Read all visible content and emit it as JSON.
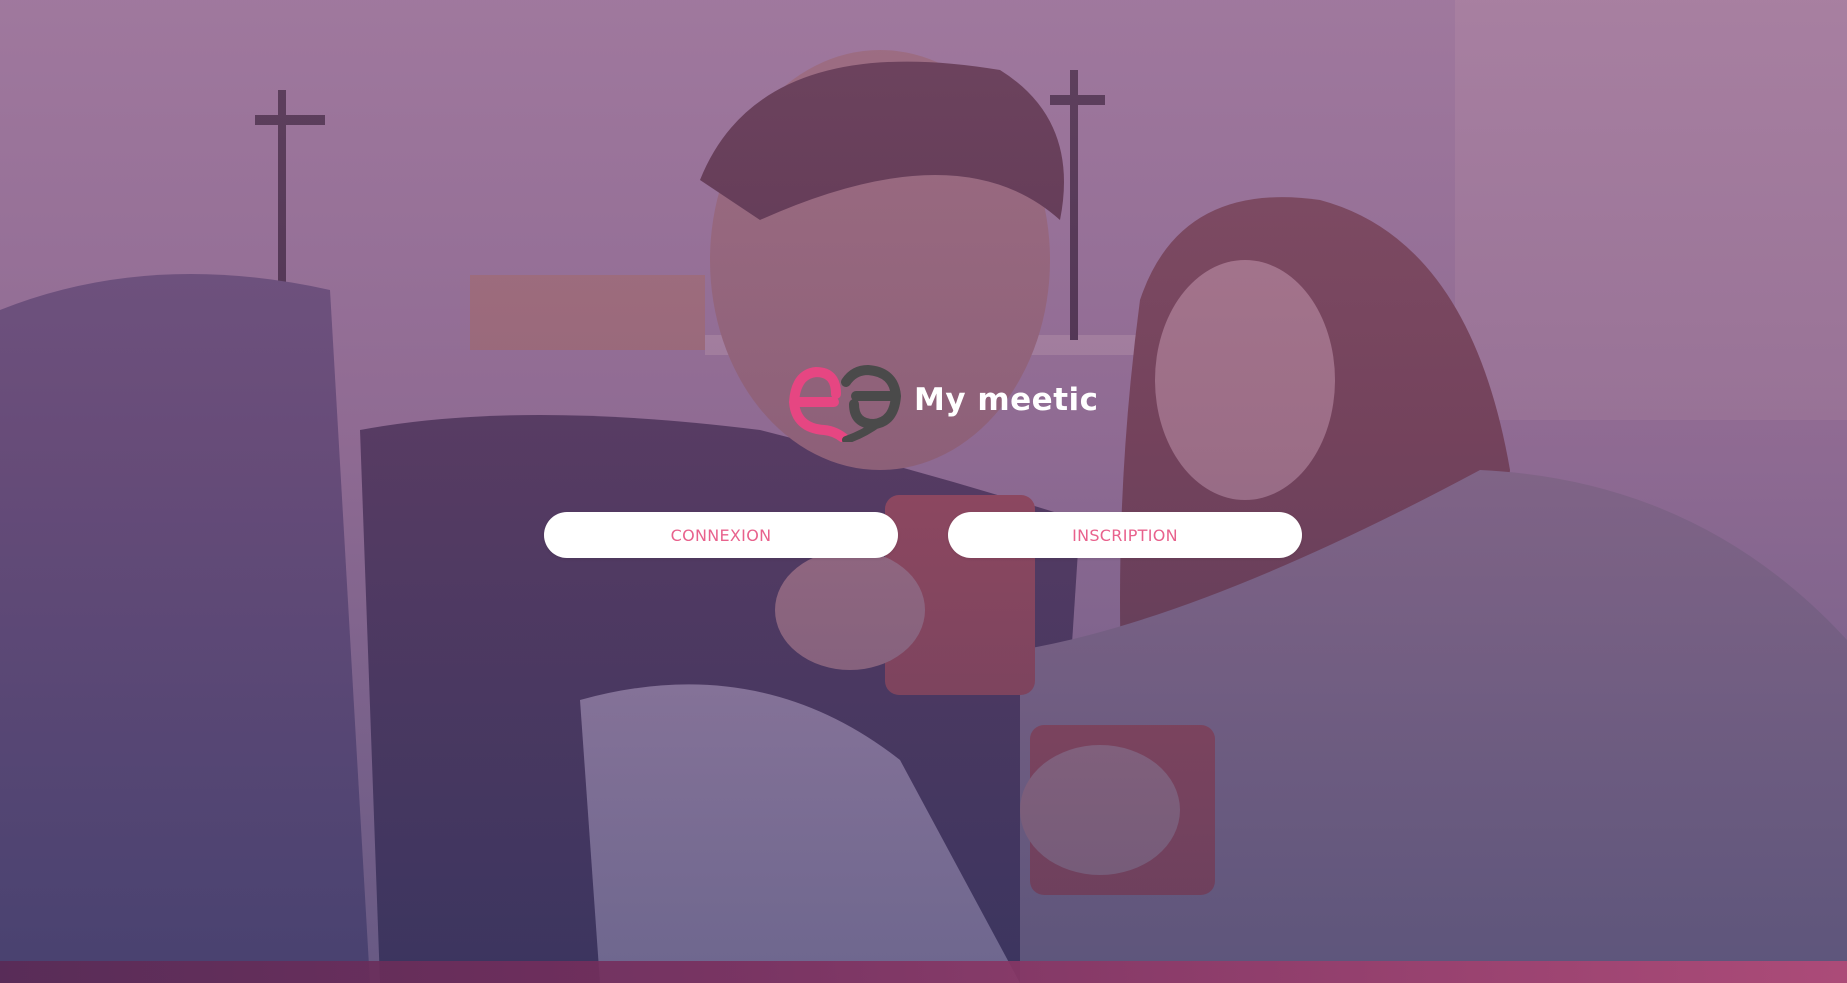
{
  "brand": {
    "name": "My meetic",
    "logo_icon": "meetic-heart-logo-icon"
  },
  "actions": {
    "login_label": "CONNEXION",
    "signup_label": "INSCRIPTION"
  },
  "colors": {
    "accent_pink": "#e8628d",
    "logo_pink": "#e64682",
    "logo_dark": "#4a4a4a",
    "overlay_purple": "#7d4f78"
  }
}
